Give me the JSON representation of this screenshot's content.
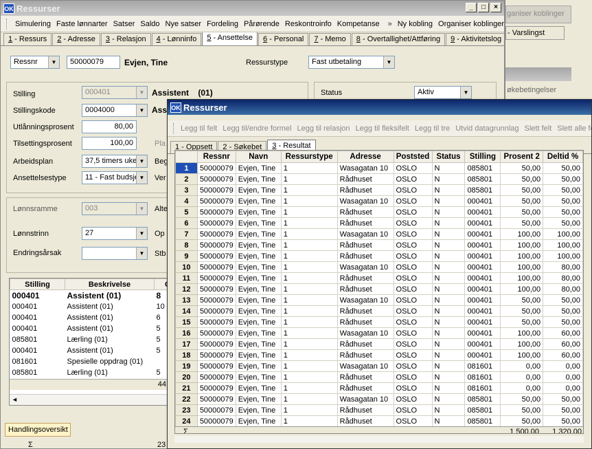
{
  "back_window": {
    "title": "Ressurser",
    "toolbar": [
      "Simulering",
      "Faste lønnarter",
      "Satser",
      "Saldo",
      "Nye satser",
      "Fordeling",
      "Pårørende",
      "Reskontroinfo",
      "Kompetanse"
    ],
    "toolbar_right": [
      "Ny kobling",
      "Organiser koblinger"
    ],
    "tabs": [
      {
        "n": "1",
        "l": " - Ressurs"
      },
      {
        "n": "2",
        "l": " - Adresse"
      },
      {
        "n": "3",
        "l": " - Relasjon"
      },
      {
        "n": "4",
        "l": " - Lønninfo"
      },
      {
        "n": "5",
        "l": " - Ansettelse"
      },
      {
        "n": "6",
        "l": " - Personal"
      },
      {
        "n": "7",
        "l": " - Memo"
      },
      {
        "n": "8",
        "l": " - Overtallighet/Attføring"
      },
      {
        "n": "9",
        "l": " - Aktivitetslog"
      }
    ],
    "key_select": "Ressnr",
    "key_value": "50000079",
    "person_name": "Evjen, Tine",
    "ressurstype_label": "Ressurstype",
    "ressurstype_value": "Fast utbetaling",
    "stilling_label": "Stilling",
    "stilling_value": "000401",
    "stilling_desc": "Assistent",
    "stilling_code": "(01)",
    "stillingskode_label": "Stillingskode",
    "stillingskode_value": "0004000",
    "stillingskode_desc": "Assi",
    "utlaan_label": "Utlånningsprosent",
    "utlaan_value": "80,00",
    "tilsetting_label": "Tilsettingsprosent",
    "tilsetting_value": "100,00",
    "pla_label": "Pla",
    "arbeidsplan_label": "Arbeidsplan",
    "arbeidsplan_value": "37,5 timers uke",
    "beg_label": "Beg",
    "ansettelsestype_label": "Ansettelsestype",
    "ansettelsestype_value": "11 - Fast budsje",
    "ver_label": "Ver",
    "status_label": "Status",
    "status_value": "Aktiv",
    "lonnsramme_label": "Lønnsramme",
    "lonnsramme_value": "003",
    "alt_label": "Alte",
    "lonnstrinn_label": "Lønnstrinn",
    "lonnstrinn_value": "27",
    "op_label": "Op",
    "endringsaarsak_label": "Endringsårsak",
    "stb_label": "Stb",
    "list_headers": [
      "Stilling",
      "Beskrivelse",
      "C"
    ],
    "list_rows": [
      {
        "s": "000401",
        "d": "Assistent   (01)",
        "c": "8",
        "bold": true
      },
      {
        "s": "000401",
        "d": "Assistent   (01)",
        "c": "10"
      },
      {
        "s": "000401",
        "d": "Assistent   (01)",
        "c": "6"
      },
      {
        "s": "000401",
        "d": "Assistent   (01)",
        "c": "5"
      },
      {
        "s": "085801",
        "d": "Lærling   (01)",
        "c": "5"
      },
      {
        "s": "000401",
        "d": "Assistent   (01)",
        "c": "5"
      },
      {
        "s": "081601",
        "d": "Spesielle oppdrag   (01)",
        "c": ""
      },
      {
        "s": "085801",
        "d": "Lærling   (01)",
        "c": "5"
      }
    ],
    "list_footer": "44",
    "bottom_tab": "Handlingsoversikt",
    "bottom_sigma": "Σ",
    "bottom_num": "23"
  },
  "right_bg": {
    "btn": "ganiser koblinger",
    "tab": " - Varslingst",
    "label": "økebetingelser"
  },
  "front_window": {
    "title": "Ressurser",
    "toolbar": [
      "Legg til felt",
      "Legg til/endre formel",
      "Legg til relasjon",
      "Legg til fleksifelt",
      "Legg til tre",
      "Utvid datagrunnlag",
      "Slett felt",
      "Slett alle felt"
    ],
    "tabs": [
      {
        "n": "1",
        "l": " - Oppsett"
      },
      {
        "n": "2",
        "l": " - Søkebet"
      },
      {
        "n": "3",
        "l": " - Resultat"
      }
    ],
    "headers": [
      "Ressnr",
      "Navn",
      "Ressurstype",
      "Adresse",
      "Poststed",
      "Status",
      "Stilling",
      "Prosent 2",
      "Deltid %"
    ],
    "rows": [
      [
        "50000079",
        "Evjen, Tine",
        "1",
        "Wasagatan 10",
        "OSLO",
        "N",
        "085801",
        "50,00",
        "50,00"
      ],
      [
        "50000079",
        "Evjen, Tine",
        "1",
        "Rådhuset",
        "OSLO",
        "N",
        "085801",
        "50,00",
        "50,00"
      ],
      [
        "50000079",
        "Evjen, Tine",
        "1",
        "Rådhuset",
        "OSLO",
        "N",
        "085801",
        "50,00",
        "50,00"
      ],
      [
        "50000079",
        "Evjen, Tine",
        "1",
        "Wasagatan 10",
        "OSLO",
        "N",
        "000401",
        "50,00",
        "50,00"
      ],
      [
        "50000079",
        "Evjen, Tine",
        "1",
        "Rådhuset",
        "OSLO",
        "N",
        "000401",
        "50,00",
        "50,00"
      ],
      [
        "50000079",
        "Evjen, Tine",
        "1",
        "Rådhuset",
        "OSLO",
        "N",
        "000401",
        "50,00",
        "50,00"
      ],
      [
        "50000079",
        "Evjen, Tine",
        "1",
        "Wasagatan 10",
        "OSLO",
        "N",
        "000401",
        "100,00",
        "100,00"
      ],
      [
        "50000079",
        "Evjen, Tine",
        "1",
        "Rådhuset",
        "OSLO",
        "N",
        "000401",
        "100,00",
        "100,00"
      ],
      [
        "50000079",
        "Evjen, Tine",
        "1",
        "Rådhuset",
        "OSLO",
        "N",
        "000401",
        "100,00",
        "100,00"
      ],
      [
        "50000079",
        "Evjen, Tine",
        "1",
        "Wasagatan 10",
        "OSLO",
        "N",
        "000401",
        "100,00",
        "80,00"
      ],
      [
        "50000079",
        "Evjen, Tine",
        "1",
        "Rådhuset",
        "OSLO",
        "N",
        "000401",
        "100,00",
        "80,00"
      ],
      [
        "50000079",
        "Evjen, Tine",
        "1",
        "Rådhuset",
        "OSLO",
        "N",
        "000401",
        "100,00",
        "80,00"
      ],
      [
        "50000079",
        "Evjen, Tine",
        "1",
        "Wasagatan 10",
        "OSLO",
        "N",
        "000401",
        "50,00",
        "50,00"
      ],
      [
        "50000079",
        "Evjen, Tine",
        "1",
        "Rådhuset",
        "OSLO",
        "N",
        "000401",
        "50,00",
        "50,00"
      ],
      [
        "50000079",
        "Evjen, Tine",
        "1",
        "Rådhuset",
        "OSLO",
        "N",
        "000401",
        "50,00",
        "50,00"
      ],
      [
        "50000079",
        "Evjen, Tine",
        "1",
        "Wasagatan 10",
        "OSLO",
        "N",
        "000401",
        "100,00",
        "60,00"
      ],
      [
        "50000079",
        "Evjen, Tine",
        "1",
        "Rådhuset",
        "OSLO",
        "N",
        "000401",
        "100,00",
        "60,00"
      ],
      [
        "50000079",
        "Evjen, Tine",
        "1",
        "Rådhuset",
        "OSLO",
        "N",
        "000401",
        "100,00",
        "60,00"
      ],
      [
        "50000079",
        "Evjen, Tine",
        "1",
        "Wasagatan 10",
        "OSLO",
        "N",
        "081601",
        "0,00",
        "0,00"
      ],
      [
        "50000079",
        "Evjen, Tine",
        "1",
        "Rådhuset",
        "OSLO",
        "N",
        "081601",
        "0,00",
        "0,00"
      ],
      [
        "50000079",
        "Evjen, Tine",
        "1",
        "Rådhuset",
        "OSLO",
        "N",
        "081601",
        "0,00",
        "0,00"
      ],
      [
        "50000079",
        "Evjen, Tine",
        "1",
        "Wasagatan 10",
        "OSLO",
        "N",
        "085801",
        "50,00",
        "50,00"
      ],
      [
        "50000079",
        "Evjen, Tine",
        "1",
        "Rådhuset",
        "OSLO",
        "N",
        "085801",
        "50,00",
        "50,00"
      ],
      [
        "50000079",
        "Evjen, Tine",
        "1",
        "Rådhuset",
        "OSLO",
        "N",
        "085801",
        "50,00",
        "50,00"
      ]
    ],
    "sigma": "Σ",
    "sum_prosent": "1 500,00",
    "sum_deltid": "1 320,00"
  },
  "colors": {
    "title_active": "#0a246a",
    "selection": "#1f4fb6",
    "face": "#ece9d8"
  }
}
